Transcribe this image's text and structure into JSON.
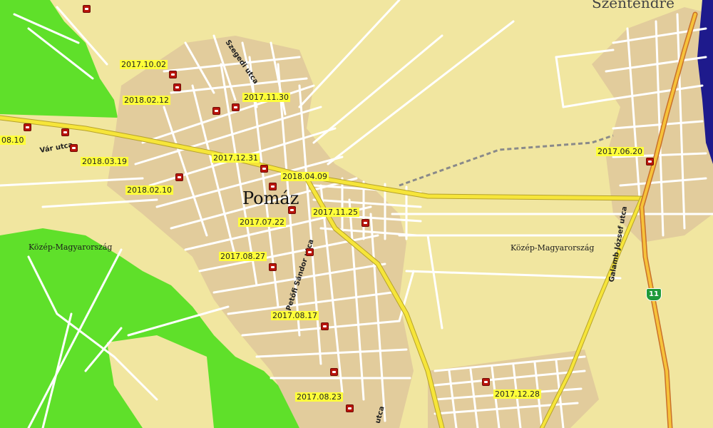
{
  "map": {
    "colors": {
      "land": "#f1e6a0",
      "forest": "#5fe02a",
      "urban": "#e2cc9c",
      "road_minor": "#ffffff",
      "road_main": "#f6e53a",
      "road_main_edge": "#b6a22a",
      "water": "#1e1a8c",
      "railway": "#8a8a8a",
      "label_bg": "#ffff3a",
      "poi": "#b8140b"
    },
    "place_labels": {
      "town": "Pomáz",
      "top_right_place": "Szentendre",
      "region_west": "Közép-Magyarország",
      "region_east": "Közép-Magyarország"
    },
    "street_labels": {
      "vari": "Vár utca",
      "szegedi": "Szegedi utca",
      "petofi": "Petőfi Sándor utca",
      "galamb": "Galamb József utca",
      "bottom": "utca"
    },
    "route_shield": "11",
    "markers": [
      {
        "id": "m1",
        "date": "2017.10.02"
      },
      {
        "id": "m2",
        "date": "2018.02.12"
      },
      {
        "id": "m3",
        "date": "2017.11.30"
      },
      {
        "id": "m4",
        "date": "08.10"
      },
      {
        "id": "m5",
        "date": "2018.03.19"
      },
      {
        "id": "m6",
        "date": "2017.12.31"
      },
      {
        "id": "m7",
        "date": "2018.04.09"
      },
      {
        "id": "m8",
        "date": "2018.02.10"
      },
      {
        "id": "m9",
        "date": "2017.11.25"
      },
      {
        "id": "m10",
        "date": "2017.07.22"
      },
      {
        "id": "m11",
        "date": "2017.08.27"
      },
      {
        "id": "m12",
        "date": "2017.08.17"
      },
      {
        "id": "m13",
        "date": "2017.08.23"
      },
      {
        "id": "m14",
        "date": "2017.12.28"
      },
      {
        "id": "m15",
        "date": "2017.06.20"
      }
    ]
  }
}
